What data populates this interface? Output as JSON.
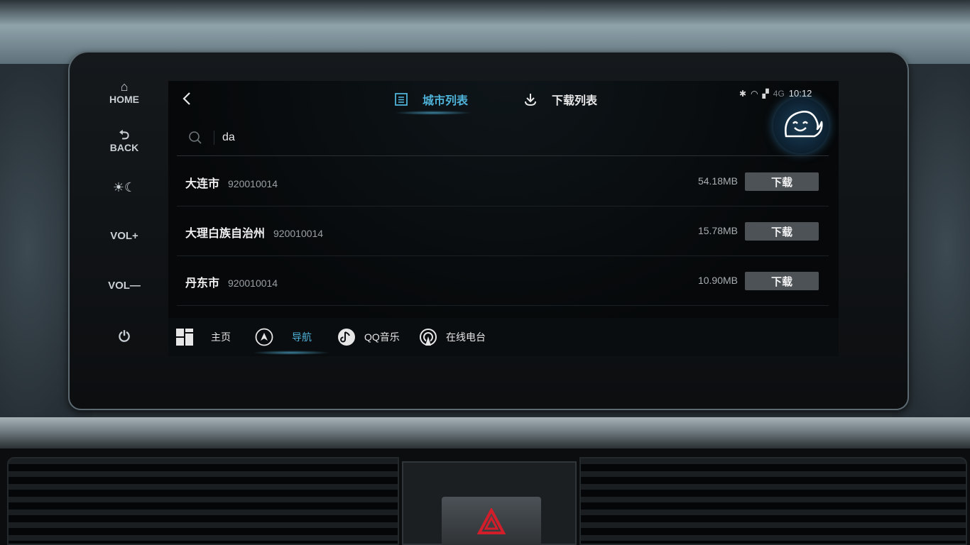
{
  "hard_keys": {
    "home": "HOME",
    "back": "BACK",
    "brightness": "☀☾",
    "vol_up": "VOL+",
    "vol_down": "VOL—"
  },
  "tabs": [
    {
      "label": "城市列表",
      "icon": "list-icon",
      "active": true
    },
    {
      "label": "下载列表",
      "icon": "download-icon",
      "active": false
    }
  ],
  "status": {
    "network": "4G",
    "time": "10:12"
  },
  "search": {
    "value": "da"
  },
  "cities": [
    {
      "name": "大连市",
      "code": "920010014",
      "size": "54.18MB",
      "action": "下载"
    },
    {
      "name": "大理白族自治州",
      "code": "920010014",
      "size": "15.78MB",
      "action": "下载"
    },
    {
      "name": "丹东市",
      "code": "920010014",
      "size": "10.90MB",
      "action": "下载"
    }
  ],
  "dock": [
    {
      "label": "主页",
      "icon": "home-grid-icon",
      "active": false
    },
    {
      "label": "导航",
      "icon": "navigation-icon",
      "active": true
    },
    {
      "label": "QQ音乐",
      "icon": "qq-music-icon",
      "active": false
    },
    {
      "label": "在线电台",
      "icon": "radio-icon",
      "active": false
    }
  ],
  "colors": {
    "accent": "#4fb3d9",
    "button_bg": "#4d5256",
    "hazard": "#d21e2b"
  }
}
